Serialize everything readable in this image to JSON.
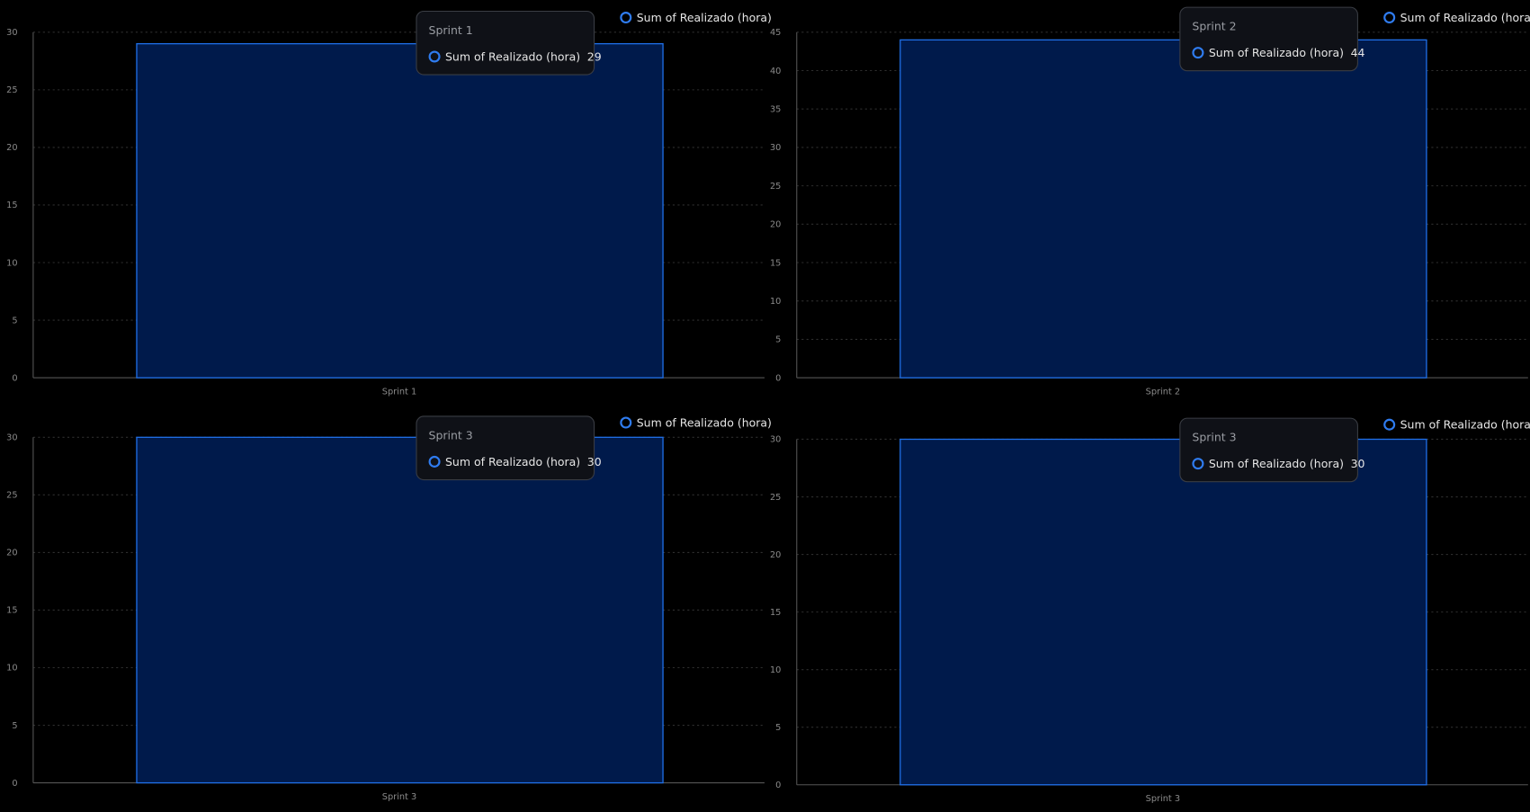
{
  "colors": {
    "bar_fill": "#001a4b",
    "bar_stroke": "#1f6fe8",
    "grid": "#2e2e2e",
    "axis": "#555555"
  },
  "chart_data": [
    {
      "type": "bar",
      "categories": [
        "Sprint 1"
      ],
      "series": [
        {
          "name": "Sum of Realizado (hora)",
          "values": [
            29
          ]
        }
      ],
      "ylim": [
        0,
        30
      ],
      "yticks": [
        "0",
        "5",
        "10",
        "15",
        "20",
        "25",
        "30"
      ],
      "legend": "top-right",
      "grid": true,
      "tooltip": {
        "title": "Sprint 1",
        "series": "Sum of Realizado (hora)",
        "value": "29"
      }
    },
    {
      "type": "bar",
      "categories": [
        "Sprint 2"
      ],
      "series": [
        {
          "name": "Sum of Realizado (hora)",
          "values": [
            44
          ]
        }
      ],
      "ylim": [
        0,
        45
      ],
      "yticks": [
        "0",
        "5",
        "10",
        "15",
        "20",
        "25",
        "30",
        "35",
        "40",
        "45"
      ],
      "legend": "top-right",
      "grid": true,
      "tooltip": {
        "title": "Sprint 2",
        "series": "Sum of Realizado (hora)",
        "value": "44"
      }
    },
    {
      "type": "bar",
      "categories": [
        "Sprint 3"
      ],
      "series": [
        {
          "name": "Sum of Realizado (hora)",
          "values": [
            30
          ]
        }
      ],
      "ylim": [
        0,
        30
      ],
      "yticks": [
        "0",
        "5",
        "10",
        "15",
        "20",
        "25",
        "30"
      ],
      "legend": "top-right",
      "grid": true,
      "tooltip": {
        "title": "Sprint 3",
        "series": "Sum of Realizado (hora)",
        "value": "30"
      }
    },
    {
      "type": "bar",
      "categories": [
        "Sprint 3"
      ],
      "series": [
        {
          "name": "Sum of Realizado (hora)",
          "values": [
            30
          ]
        }
      ],
      "ylim": [
        0,
        30
      ],
      "yticks": [
        "0",
        "5",
        "10",
        "15",
        "20",
        "25",
        "30"
      ],
      "legend": "top-right",
      "grid": true,
      "tooltip": {
        "title": "Sprint 3",
        "series": "Sum of Realizado (hora)",
        "value": "30"
      }
    }
  ]
}
